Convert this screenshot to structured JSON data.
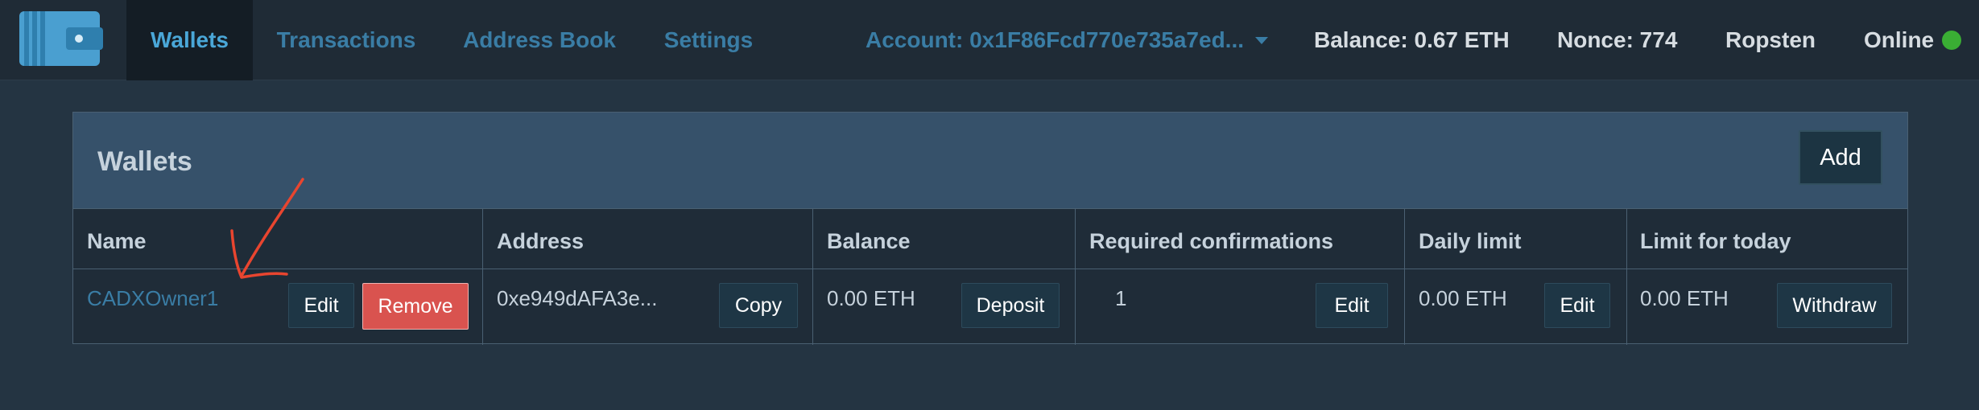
{
  "nav": {
    "items": [
      "Wallets",
      "Transactions",
      "Address Book",
      "Settings"
    ],
    "active": "Wallets",
    "account_label": "Account: 0x1F86Fcd770e735a7ed...",
    "balance_label": "Balance: 0.67 ETH",
    "nonce_label": "Nonce: 774",
    "network_label": "Ropsten",
    "status_label": "Online",
    "status_color": "#3aae34"
  },
  "panel": {
    "title": "Wallets",
    "add_label": "Add"
  },
  "table": {
    "headers": [
      "Name",
      "Address",
      "Balance",
      "Required confirmations",
      "Daily limit",
      "Limit for today"
    ],
    "rows": [
      {
        "name": "CADXOwner1",
        "address": "0xe949dAFA3e...",
        "balance": "0.00 ETH",
        "required_confirmations": "1",
        "daily_limit": "0.00 ETH",
        "limit_for_today": "0.00 ETH"
      }
    ],
    "actions": {
      "edit": "Edit",
      "remove": "Remove",
      "copy": "Copy",
      "deposit": "Deposit",
      "withdraw": "Withdraw"
    }
  },
  "colors": {
    "accent": "#4aa7d8",
    "link": "#3a7da5",
    "remove": "#d9534f",
    "annotation": "#e8452f"
  }
}
